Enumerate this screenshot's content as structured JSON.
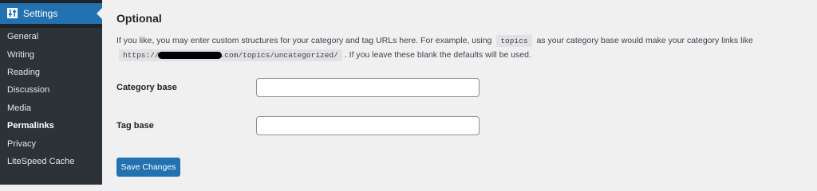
{
  "sidebar": {
    "header": {
      "label": "Settings",
      "icon": "settings-sliders-icon"
    },
    "items": [
      {
        "label": "General"
      },
      {
        "label": "Writing"
      },
      {
        "label": "Reading"
      },
      {
        "label": "Discussion"
      },
      {
        "label": "Media"
      },
      {
        "label": "Permalinks",
        "current": true
      },
      {
        "label": "Privacy"
      },
      {
        "label": "LiteSpeed Cache"
      }
    ]
  },
  "main": {
    "title": "Optional",
    "description": {
      "line1_a": "If you like, you may enter custom structures for your category and tag URLs here. For example, using",
      "code1": "topics",
      "line1_b": "as your category base would make your category links like",
      "code2_start": "https://",
      "code2_end": ".com/topics/uncategorized/",
      "line2": ". If you leave these blank the defaults will be used."
    },
    "fields": [
      {
        "label": "Category base",
        "value": "",
        "placeholder": ""
      },
      {
        "label": "Tag base",
        "value": "",
        "placeholder": ""
      }
    ],
    "save_label": "Save Changes"
  },
  "colors": {
    "accent": "#2271b1",
    "sidebar_bg": "#1d2327",
    "submenu_bg": "#2c3338",
    "page_bg": "#f0f0f1"
  }
}
